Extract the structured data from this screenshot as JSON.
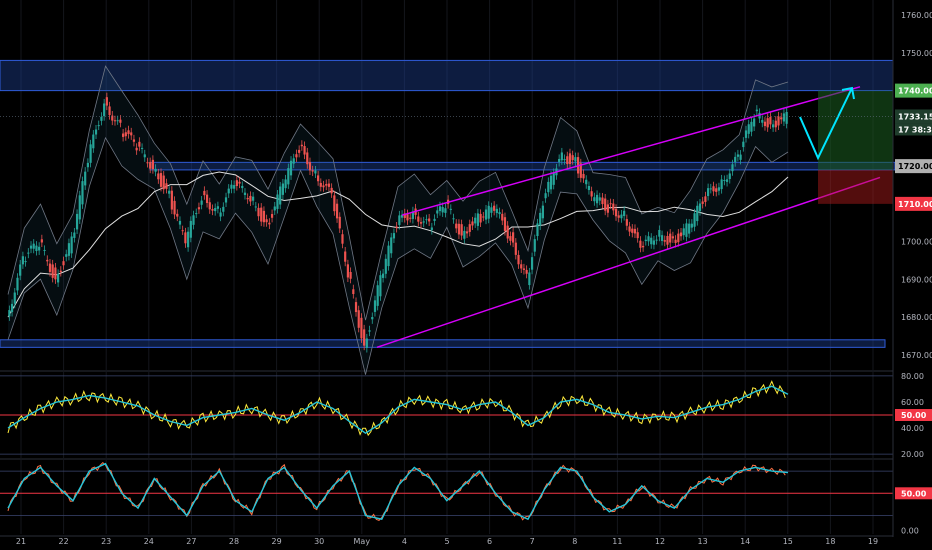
{
  "chart_data": [
    {
      "type": "candlestick",
      "x_ticks": [
        "21",
        "22",
        "23",
        "24",
        "27",
        "28",
        "29",
        "30",
        "May",
        "4",
        "5",
        "6",
        "7",
        "8",
        "11",
        "12",
        "13",
        "14",
        "15",
        "18",
        "19"
      ],
      "y_ticks": [
        1670,
        1680,
        1690,
        1700,
        1710,
        1720,
        1730,
        1740,
        1750,
        1760
      ],
      "ylim": [
        1666,
        1764
      ],
      "last_price": 1733.155,
      "last_price_label": "1733.155",
      "countdown_label": "38:37",
      "countdown_prefix": "17",
      "price_tags": [
        {
          "value": 1740,
          "label": "1740.000",
          "color": "#4caf50"
        },
        {
          "value": 1720,
          "label": "1720.000",
          "color": "#b0b0b0"
        },
        {
          "value": 1710,
          "label": "1710.000",
          "color": "#f23645"
        }
      ],
      "zones": [
        {
          "from": 1740,
          "to": 1748,
          "color": "#1c3f8f"
        },
        {
          "from": 1719,
          "to": 1721,
          "color": "#1c3f8f"
        },
        {
          "from": 1672,
          "to": 1674,
          "color": "#1c3f8f"
        }
      ],
      "channel": {
        "upper": [
          [
            1707,
            1743
          ],
          [
            1741,
            1743
          ]
        ],
        "lower": [
          [
            1672,
            1720
          ],
          [
            1717,
            1720
          ]
        ]
      },
      "close": [
        1680,
        1695,
        1700,
        1690,
        1700,
        1722,
        1737,
        1730,
        1725,
        1720,
        1712,
        1700,
        1712,
        1708,
        1715,
        1712,
        1704,
        1715,
        1725,
        1718,
        1712,
        1692,
        1672,
        1690,
        1705,
        1708,
        1704,
        1710,
        1702,
        1706,
        1709,
        1701,
        1690,
        1710,
        1723,
        1721,
        1712,
        1709,
        1707,
        1698,
        1702,
        1700,
        1704,
        1712,
        1716,
        1722,
        1734,
        1731,
        1733
      ]
    },
    {
      "type": "line",
      "name": "RSI",
      "y_ticks": [
        20,
        40,
        50,
        60,
        80
      ],
      "ylim": [
        17,
        83
      ],
      "level": 50,
      "level_label": "50.00",
      "values": [
        40,
        48,
        55,
        60,
        62,
        65,
        63,
        60,
        57,
        50,
        45,
        42,
        48,
        50,
        52,
        55,
        50,
        46,
        52,
        60,
        55,
        45,
        36,
        44,
        56,
        62,
        60,
        58,
        54,
        58,
        60,
        52,
        42,
        48,
        60,
        62,
        58,
        52,
        50,
        47,
        49,
        48,
        52,
        56,
        58,
        62,
        68,
        72,
        66
      ]
    },
    {
      "type": "line",
      "name": "Stochastic",
      "y_ticks": [
        0,
        50
      ],
      "ylim": [
        -5,
        95
      ],
      "level": 50,
      "level_label": "50.00",
      "values": [
        30,
        70,
        85,
        60,
        40,
        80,
        90,
        50,
        30,
        70,
        45,
        20,
        60,
        80,
        40,
        25,
        70,
        85,
        55,
        30,
        60,
        80,
        20,
        15,
        60,
        85,
        70,
        40,
        60,
        80,
        50,
        25,
        15,
        55,
        85,
        80,
        45,
        25,
        35,
        60,
        40,
        30,
        55,
        70,
        65,
        80,
        85,
        80,
        78
      ]
    }
  ]
}
